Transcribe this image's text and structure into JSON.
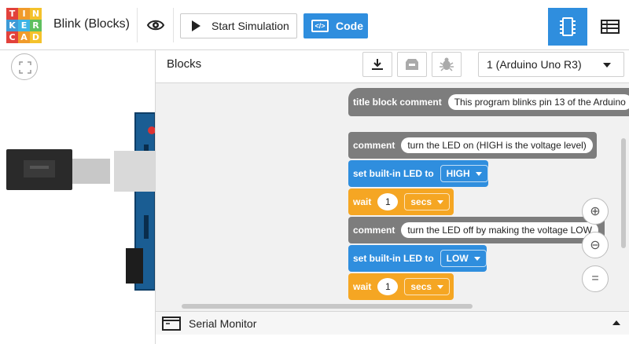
{
  "app": {
    "title": "Blink (Blocks)",
    "logo_letters": [
      "T",
      "I",
      "N",
      "K",
      "E",
      "R",
      "C",
      "A",
      "D"
    ],
    "logo_colors": [
      "#e2413b",
      "#f09b2b",
      "#f4c22b",
      "#3d9ad7",
      "#3cb4e5",
      "#5fbf5f",
      "#e2413b",
      "#f09b2b",
      "#f4c22b"
    ]
  },
  "toolbar": {
    "visibility_icon": "eye-icon",
    "start_simulation_label": "Start Simulation",
    "code_label": "Code",
    "accent_color": "#2f8ede"
  },
  "code_panel": {
    "title": "Blocks",
    "tools": [
      "download-icon",
      "upload-icon",
      "debug-icon"
    ],
    "device_selected": "1 (Arduino Uno R3)"
  },
  "blocks": {
    "title_comment": {
      "label": "title block comment",
      "text": "This program blinks pin 13 of the Arduino"
    },
    "comment1": {
      "label": "comment",
      "text": "turn the LED on (HIGH is the voltage level)"
    },
    "set1": {
      "label": "set built-in LED to",
      "value": "HIGH"
    },
    "wait1": {
      "label": "wait",
      "amount": "1",
      "unit": "secs"
    },
    "comment2": {
      "label": "comment",
      "text": "turn the LED off by making the voltage LOW"
    },
    "set2": {
      "label": "set built-in LED to",
      "value": "LOW"
    },
    "wait2": {
      "label": "wait",
      "amount": "1",
      "unit": "secs"
    }
  },
  "zoom_controls": {
    "zoom_in": "⊕",
    "zoom_out": "⊖",
    "reset": "="
  },
  "serial_monitor": {
    "label": "Serial Monitor"
  }
}
